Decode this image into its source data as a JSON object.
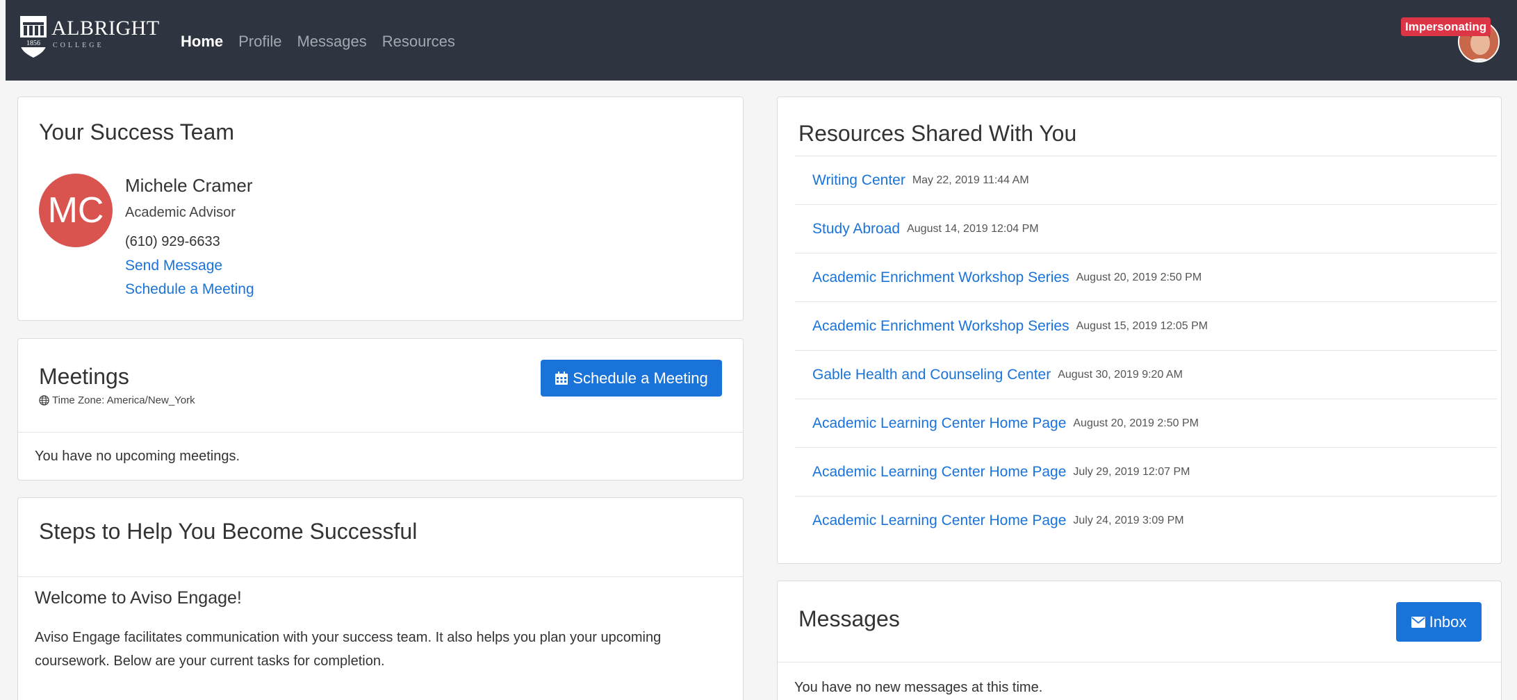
{
  "brand": {
    "name": "ALBRIGHT",
    "subtitle": "COLLEGE",
    "year": "1856"
  },
  "nav": {
    "items": [
      {
        "label": "Home",
        "active": true
      },
      {
        "label": "Profile",
        "active": false
      },
      {
        "label": "Messages",
        "active": false
      },
      {
        "label": "Resources",
        "active": false
      }
    ]
  },
  "user": {
    "badge": "Impersonating"
  },
  "success_team": {
    "title": "Your Success Team",
    "advisor": {
      "initials": "MC",
      "name": "Michele Cramer",
      "role": "Academic Advisor",
      "phone": "(610) 929-6633",
      "send_message": "Send Message",
      "schedule": "Schedule a Meeting"
    }
  },
  "meetings": {
    "title": "Meetings",
    "timezone": "Time Zone: America/New_York",
    "button": "Schedule a Meeting",
    "empty": "You have no upcoming meetings."
  },
  "steps": {
    "title": "Steps to Help You Become Successful",
    "welcome_title": "Welcome to Aviso Engage!",
    "welcome_body": "Aviso Engage facilitates communication with your success team. It also helps you plan your upcoming coursework. Below are your current tasks for completion."
  },
  "resources": {
    "title": "Resources Shared With You",
    "items": [
      {
        "name": "Writing Center",
        "date": "May 22, 2019 11:44 AM"
      },
      {
        "name": "Study Abroad",
        "date": "August 14, 2019 12:04 PM"
      },
      {
        "name": "Academic Enrichment Workshop Series",
        "date": "August 20, 2019 2:50 PM"
      },
      {
        "name": "Academic Enrichment Workshop Series",
        "date": "August 15, 2019 12:05 PM"
      },
      {
        "name": "Gable Health and Counseling Center",
        "date": "August 30, 2019 9:20 AM"
      },
      {
        "name": "Academic Learning Center Home Page",
        "date": "August 20, 2019 2:50 PM"
      },
      {
        "name": "Academic Learning Center Home Page",
        "date": "July 29, 2019 12:07 PM"
      },
      {
        "name": "Academic Learning Center Home Page",
        "date": "July 24, 2019 3:09 PM"
      }
    ]
  },
  "messages": {
    "title": "Messages",
    "button": "Inbox",
    "empty": "You have no new messages at this time."
  }
}
